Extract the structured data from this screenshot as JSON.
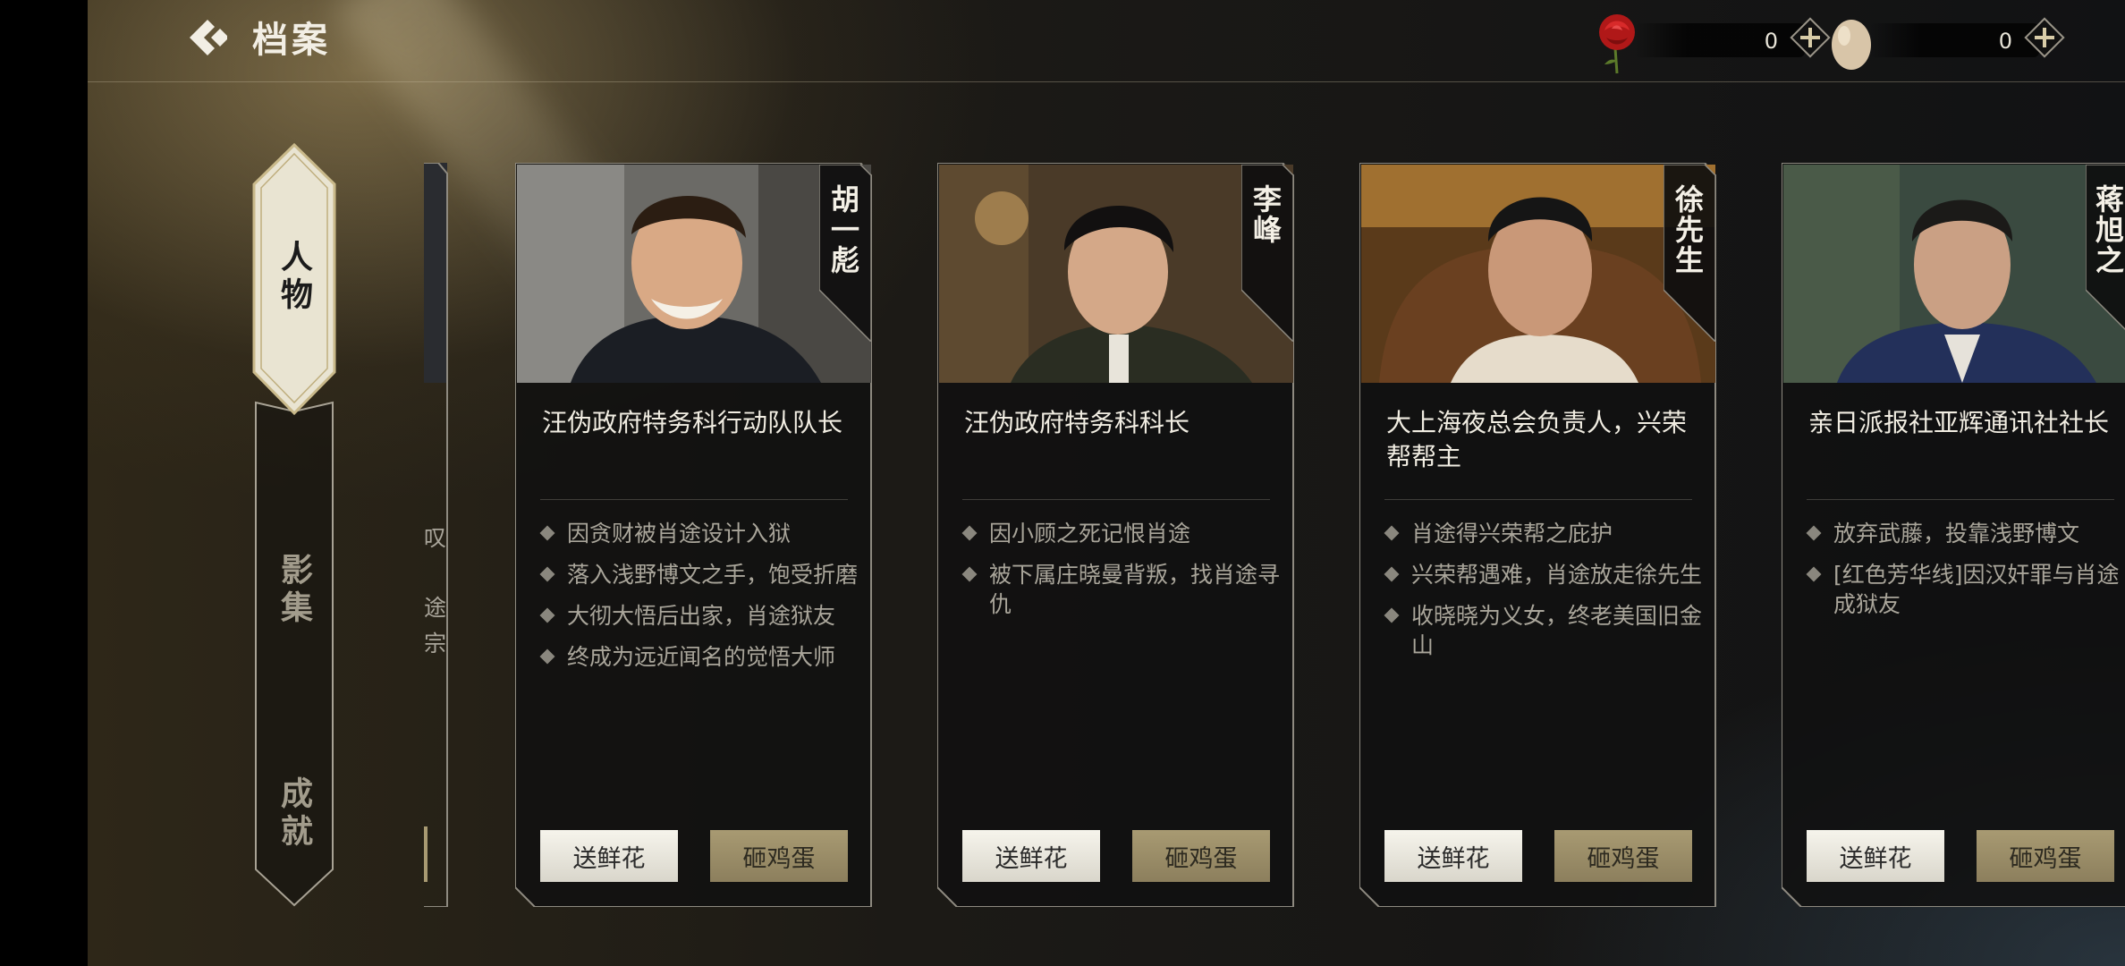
{
  "header": {
    "title": "档案"
  },
  "currencies": [
    {
      "icon": "rose-icon",
      "value": "0"
    },
    {
      "icon": "egg-icon",
      "value": "0"
    }
  ],
  "tabs": [
    {
      "label": "人物",
      "selected": true
    },
    {
      "label": "影集",
      "selected": false
    },
    {
      "label": "成就",
      "selected": false
    }
  ],
  "partial_card": {
    "fragments": [
      "叹",
      "途",
      "宗"
    ]
  },
  "characters": [
    {
      "name": "胡一彪",
      "role": "汪伪政府特务科行动队队长",
      "events": [
        "因贪财被肖途设计入狱",
        "落入浅野博文之手，饱受折磨",
        "大彻大悟后出家，肖途狱友",
        "终成为远近闻名的觉悟大师"
      ],
      "flower_label": "送鲜花",
      "egg_label": "砸鸡蛋"
    },
    {
      "name": "李峰",
      "role": "汪伪政府特务科科长",
      "events": [
        "因小顾之死记恨肖途",
        "被下属庄晓曼背叛，找肖途寻仇"
      ],
      "flower_label": "送鲜花",
      "egg_label": "砸鸡蛋"
    },
    {
      "name": "徐先生",
      "role": "大上海夜总会负责人，兴荣帮帮主",
      "events": [
        "肖途得兴荣帮之庇护",
        "兴荣帮遇难，肖途放走徐先生",
        "收晓晓为义女，终老美国旧金山"
      ],
      "flower_label": "送鲜花",
      "egg_label": "砸鸡蛋"
    },
    {
      "name": "蒋旭之",
      "role": "亲日派报社亚辉通讯社社长",
      "events": [
        "放弃武藤，投靠浅野博文",
        "[红色芳华线]因汉奸罪与肖途成狱友"
      ],
      "flower_label": "送鲜花",
      "egg_label": "砸鸡蛋"
    }
  ]
}
